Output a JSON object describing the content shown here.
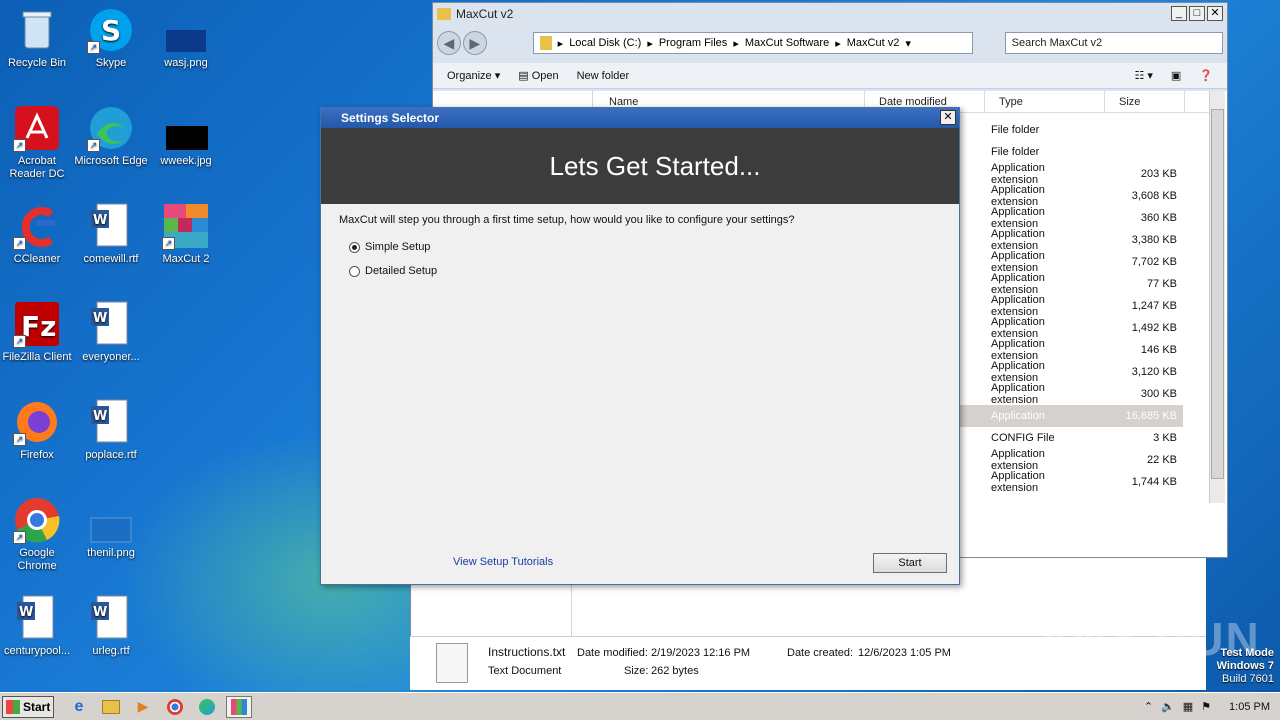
{
  "desktop": {
    "icons": [
      {
        "label": "Recycle Bin"
      },
      {
        "label": "Skype"
      },
      {
        "label": "wasj.png"
      },
      {
        "label": "Acrobat Reader DC"
      },
      {
        "label": "Microsoft Edge"
      },
      {
        "label": "wweek.jpg"
      },
      {
        "label": "CCleaner"
      },
      {
        "label": "comewill.rtf"
      },
      {
        "label": "MaxCut 2"
      },
      {
        "label": "FileZilla Client"
      },
      {
        "label": "everyoner..."
      },
      {
        "label": "Firefox"
      },
      {
        "label": "poplace.rtf"
      },
      {
        "label": "Google Chrome"
      },
      {
        "label": "thenil.png"
      },
      {
        "label": "centurypool..."
      },
      {
        "label": "urleg.rtf"
      }
    ]
  },
  "explorer": {
    "title": "MaxCut v2",
    "breadcrumb": [
      "Local Disk (C:)",
      "Program Files",
      "MaxCut Software",
      "MaxCut v2"
    ],
    "search_placeholder": "Search MaxCut v2",
    "toolbar": {
      "organize": "Organize",
      "open": "Open",
      "new_folder": "New folder"
    },
    "columns": {
      "name": "Name",
      "date": "Date modified",
      "type": "Type",
      "size": "Size"
    },
    "rows": [
      {
        "type": "File folder",
        "size": ""
      },
      {
        "type": "File folder",
        "size": ""
      },
      {
        "type": "Application extension",
        "size": "203 KB"
      },
      {
        "type": "Application extension",
        "size": "3,608 KB"
      },
      {
        "type": "Application extension",
        "size": "360 KB"
      },
      {
        "type": "Application extension",
        "size": "3,380 KB"
      },
      {
        "type": "Application extension",
        "size": "7,702 KB"
      },
      {
        "type": "Application extension",
        "size": "77 KB"
      },
      {
        "type": "Application extension",
        "size": "1,247 KB"
      },
      {
        "type": "Application extension",
        "size": "1,492 KB"
      },
      {
        "type": "Application extension",
        "size": "146 KB"
      },
      {
        "type": "Application extension",
        "size": "3,120 KB"
      },
      {
        "type": "Application extension",
        "size": "300 KB"
      },
      {
        "type": "Application",
        "size": "16,685 KB"
      },
      {
        "type": "CONFIG File",
        "size": "3 KB"
      },
      {
        "type": "Application extension",
        "size": "22 KB"
      },
      {
        "type": "Application extension",
        "size": "1,744 KB"
      }
    ],
    "details": {
      "filename": "Instructions.txt",
      "filetype": "Text Document",
      "modified_label": "Date modified:",
      "modified_value": "2/19/2023 12:16 PM",
      "created_label": "Date created:",
      "created_value": "12/6/2023 1:05 PM",
      "size_label": "Size:",
      "size_value": "262 bytes"
    }
  },
  "dialog": {
    "title": "Settings Selector",
    "banner": "Lets Get Started...",
    "question": "MaxCut will step you through a first time setup, how would you like to configure your settings?",
    "options": [
      {
        "label": "Simple Setup",
        "selected": true
      },
      {
        "label": "Detailed Setup",
        "selected": false
      }
    ],
    "tutorial_link": "View Setup Tutorials",
    "start_button": "Start"
  },
  "taskbar": {
    "start_label": "Start",
    "clock": "1:05 PM"
  },
  "watermark": {
    "line1": "Test Mode",
    "line2": "Windows 7",
    "line3": "Build 7601",
    "brand": "ANY RUN"
  }
}
